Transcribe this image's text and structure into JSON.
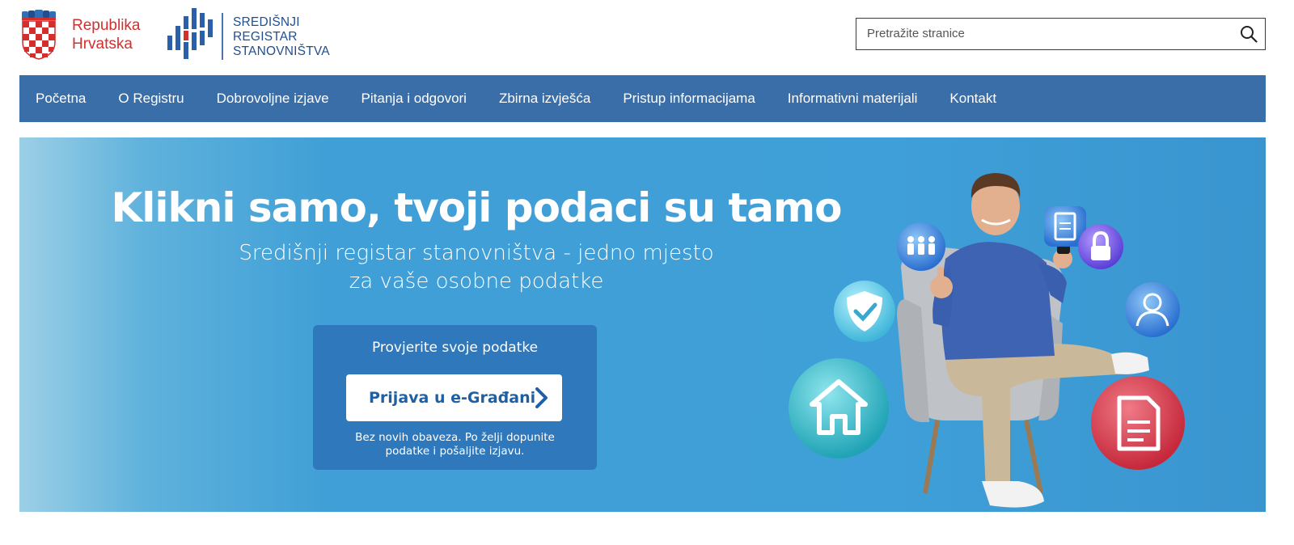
{
  "header": {
    "country_line1": "Republika",
    "country_line2": "Hrvatska",
    "srs_line1": "SREDIŠNJI",
    "srs_line2": "REGISTAR",
    "srs_line3": "STANOVNIŠTVA",
    "search_placeholder": "Pretražite stranice",
    "search_icon": "search-icon"
  },
  "nav": {
    "items": [
      {
        "label": "Početna"
      },
      {
        "label": "O Registru"
      },
      {
        "label": "Dobrovoljne izjave"
      },
      {
        "label": "Pitanja i odgovori"
      },
      {
        "label": "Zbirna izvješća"
      },
      {
        "label": "Pristup informacijama"
      },
      {
        "label": "Informativni materijali"
      },
      {
        "label": "Kontakt"
      }
    ]
  },
  "hero": {
    "title": "Klikni samo, tvoji podaci su tamo",
    "subtitle_line1": "Središnji registar stanovništva - jedno mjesto",
    "subtitle_line2": "za vaše osobne podatke",
    "cta_title": "Provjerite svoje podatke",
    "cta_button": "Prijava u e-Građani",
    "cta_note_line1": "Bez novih obaveza. Po želji dopunite",
    "cta_note_line2": "podatke i pošaljite izjavu."
  },
  "colors": {
    "nav_bg": "#3a6ea9",
    "brand_red": "#d32f2f",
    "brand_blue": "#1f4f8f",
    "hero_blue": "#3f9fd6",
    "cta_box": "#2e78bb"
  }
}
